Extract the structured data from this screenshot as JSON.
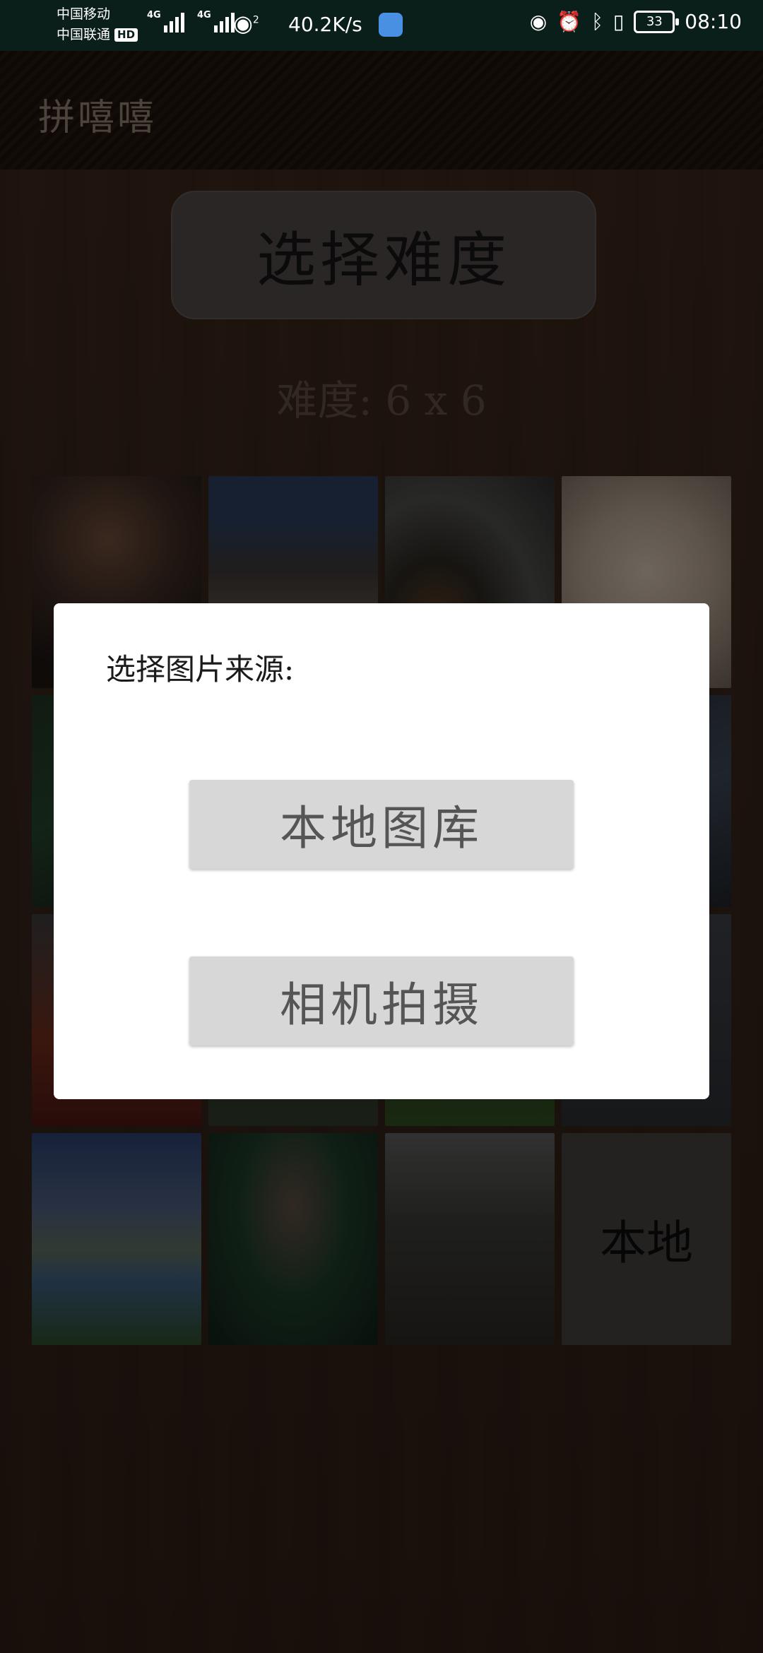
{
  "status_bar": {
    "carrier_1": "中国移动",
    "carrier_2": "中国联通",
    "hd_badge": "HD",
    "network_1": "4G",
    "network_2": "4G",
    "wifi_sup": "2",
    "speed": "40.2K/s",
    "battery": "33",
    "time": "08:10"
  },
  "app": {
    "title": "拼嘻嘻"
  },
  "main": {
    "difficulty_button_label": "选择难度",
    "difficulty_text": "难度: 6 x 6",
    "last_tile_label": "本地"
  },
  "dialog": {
    "title": "选择图片来源:",
    "local_gallery_label": "本地图库",
    "camera_label": "相机拍摄"
  },
  "colors": {
    "dialog_bg": "#ffffff",
    "dialog_button_bg": "#d7d7d7",
    "status_bar_bg": "#0b1f1a"
  }
}
